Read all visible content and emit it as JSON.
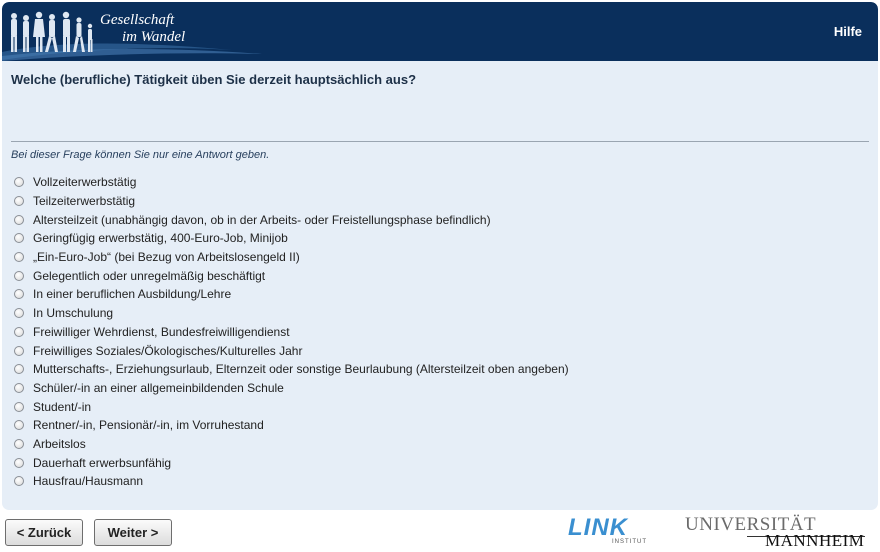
{
  "header": {
    "brand_line1": "Gesellschaft",
    "brand_line2": "im Wandel",
    "help_label": "Hilfe",
    "brand_color": "#0a2f5c"
  },
  "question": {
    "text": "Welche (berufliche) Tätigkeit üben Sie derzeit hauptsächlich aus?",
    "instruction": "Bei dieser Frage können Sie nur eine Antwort geben."
  },
  "options": [
    "Vollzeiterwerbstätig",
    "Teilzeiterwerbstätig",
    "Altersteilzeit (unabhängig davon, ob in der Arbeits- oder Freistellungsphase befindlich)",
    "Geringfügig erwerbstätig, 400-Euro-Job, Minijob",
    "„Ein-Euro-Job“ (bei Bezug von Arbeitslosengeld II)",
    "Gelegentlich oder unregelmäßig beschäftigt",
    "In einer beruflichen Ausbildung/Lehre",
    "In Umschulung",
    "Freiwilliger Wehrdienst, Bundesfreiwilligendienst",
    "Freiwilliges Soziales/Ökologisches/Kulturelles Jahr",
    "Mutterschafts-, Erziehungsurlaub, Elternzeit oder sonstige Beurlaubung (Altersteilzeit oben angeben)",
    "Schüler/-in an einer allgemeinbildenden Schule",
    "Student/-in",
    "Rentner/-in, Pensionär/-in, im Vorruhestand",
    "Arbeitslos",
    "Dauerhaft erwerbsunfähig",
    "Hausfrau/Hausmann"
  ],
  "navigation": {
    "back_label": "< Zurück",
    "next_label": "Weiter >"
  },
  "logos": {
    "link": "LINK",
    "link_sub": "INSTITUT",
    "uni_line1": "UNIVERSITÄT",
    "uni_line2": "MANNHEIM"
  }
}
